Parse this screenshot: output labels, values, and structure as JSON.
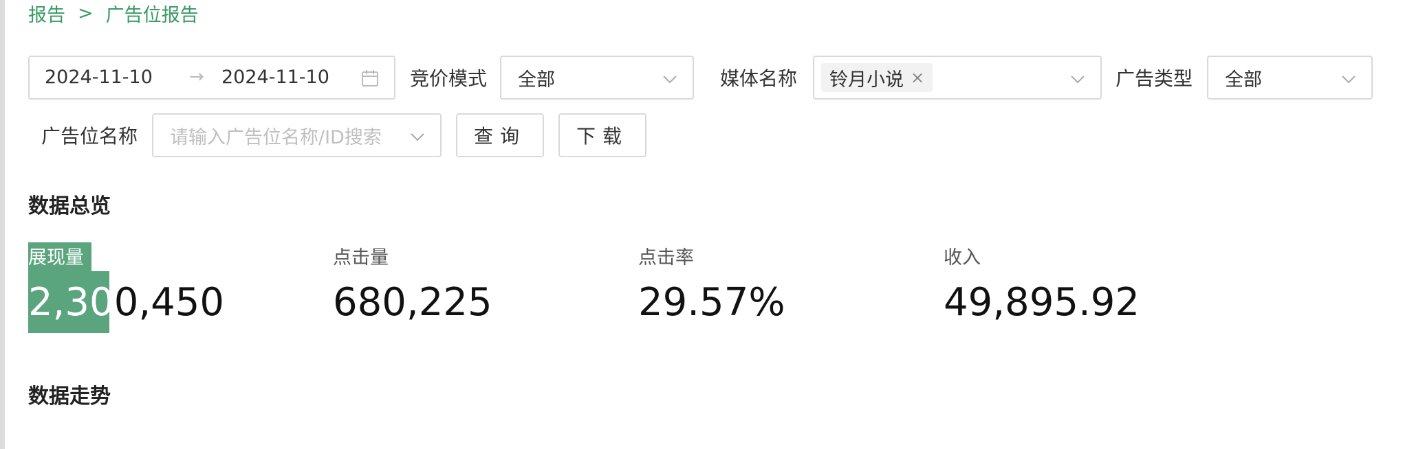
{
  "breadcrumb": {
    "parent": "报告",
    "separator": ">",
    "current": "广告位报告"
  },
  "filters": {
    "date_start": "2024-11-10",
    "date_arrow": "→",
    "date_end": "2024-11-10",
    "bid_mode_label": "竞价模式",
    "bid_mode_value": "全部",
    "media_label": "媒体名称",
    "media_tag": "铃月小说",
    "media_tag_close": "×",
    "ad_type_label": "广告类型",
    "ad_type_value": "全部",
    "slot_name_label": "广告位名称",
    "slot_name_placeholder": "请输入广告位名称/ID搜索"
  },
  "buttons": {
    "query": "查询",
    "download": "下载"
  },
  "overview": {
    "title": "数据总览",
    "stats": [
      {
        "label": "展现量",
        "value": "2,300,450"
      },
      {
        "label": "点击量",
        "value": "680,225"
      },
      {
        "label": "点击率",
        "value": "29.57%"
      },
      {
        "label": "收入",
        "value": "49,895.92"
      }
    ]
  },
  "trend": {
    "title": "数据走势"
  },
  "colors": {
    "accent": "#3a9a63",
    "highlight": "#5aa57e",
    "border": "#d9d9d9"
  }
}
